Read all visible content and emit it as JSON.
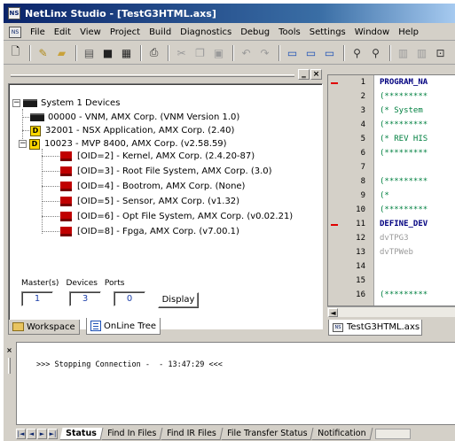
{
  "window": {
    "title": "NetLinx Studio - [TestG3HTML.axs]",
    "app_icon": "NS"
  },
  "menubar": {
    "doc_icon": "NS",
    "items": [
      "File",
      "Edit",
      "View",
      "Project",
      "Build",
      "Diagnostics",
      "Debug",
      "Tools",
      "Settings",
      "Window",
      "Help"
    ]
  },
  "toolbar": {
    "icons": [
      "new-file-icon",
      "open-icon",
      "open-folder-icon",
      "save-icon",
      "save-all-icon",
      "print-icon",
      "cut-icon",
      "copy-icon",
      "paste-icon",
      "undo-icon",
      "redo-icon",
      "layout-icon",
      "compile-icon",
      "build-icon",
      "find-icon",
      "find-next-icon",
      "send-icon",
      "receive-icon",
      "transfer-icon"
    ]
  },
  "workspace": {
    "tree": {
      "root": "System 1 Devices",
      "devices": [
        {
          "label": "00000 - VNM, AMX Corp. (VNM Version 1.0)",
          "icon": "monitor-icon"
        },
        {
          "label": "32001 - NSX Application, AMX Corp. (2.40)",
          "icon": "device-icon"
        },
        {
          "label": "10023 - MVP 8400, AMX Corp. (v2.58.59)",
          "icon": "device-icon"
        }
      ],
      "children": [
        "[OID=2] - Kernel, AMX Corp. (2.4.20-87)",
        "[OID=3] - Root File System, AMX Corp. (3.0)",
        "[OID=4] - Bootrom, AMX Corp. (None)",
        "[OID=5] - Sensor, AMX Corp. (v1.32)",
        "[OID=6] - Opt File System, AMX Corp. (v0.02.21)",
        "[OID=8] - Fpga, AMX Corp. (v7.00.1)"
      ]
    },
    "mdp": {
      "labels": [
        "Master(s)",
        "Devices",
        "Ports"
      ],
      "values": [
        "1",
        "3",
        "0"
      ],
      "display_label": "Display"
    },
    "tabs": [
      "Workspace",
      "OnLine Tree"
    ]
  },
  "editor": {
    "lines": [
      {
        "n": "1",
        "text": "PROGRAM_NA",
        "style": "kw",
        "fold": true
      },
      {
        "n": "2",
        "text": "(*********",
        "style": "cm"
      },
      {
        "n": "3",
        "text": "(* System",
        "style": "cm"
      },
      {
        "n": "4",
        "text": "(*********",
        "style": "cm"
      },
      {
        "n": "5",
        "text": "(* REV HIS",
        "style": "cm"
      },
      {
        "n": "6",
        "text": "(*********",
        "style": "cm"
      },
      {
        "n": "7",
        "text": "",
        "style": ""
      },
      {
        "n": "8",
        "text": "(*********",
        "style": "cm"
      },
      {
        "n": "9",
        "text": "(*",
        "style": "cm"
      },
      {
        "n": "10",
        "text": "(*********",
        "style": "cm"
      },
      {
        "n": "11",
        "text": "DEFINE_DEV",
        "style": "kw",
        "fold": true
      },
      {
        "n": "12",
        "text": "dvTPG3",
        "style": "grey"
      },
      {
        "n": "13",
        "text": "dvTPWeb",
        "style": "grey"
      },
      {
        "n": "14",
        "text": "",
        "style": ""
      },
      {
        "n": "15",
        "text": "",
        "style": ""
      },
      {
        "n": "16",
        "text": "(*********",
        "style": "cm"
      }
    ],
    "tab_label": "TestG3HTML.axs",
    "tab_icon": "NS"
  },
  "output": {
    "message": ">>> Stopping Connection -  - 13:47:29 <<<",
    "tabs": [
      "Status",
      "Find In Files",
      "Find IR Files",
      "File Transfer Status",
      "Notification"
    ],
    "nav": [
      "|◄",
      "◄",
      "►",
      "►|"
    ]
  }
}
